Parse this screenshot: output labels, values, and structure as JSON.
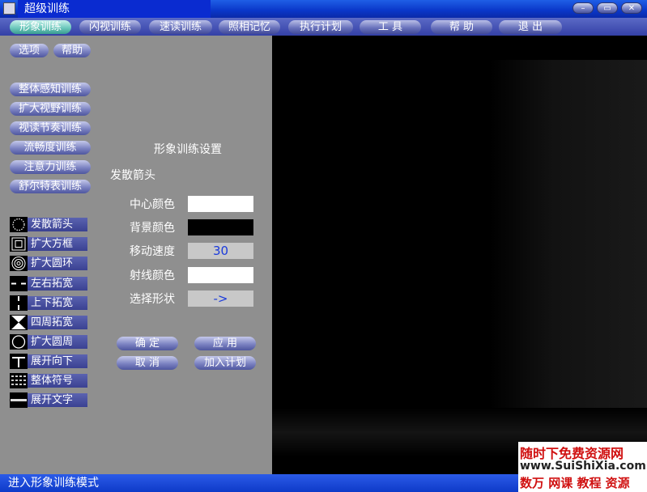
{
  "window": {
    "title": "超级训练",
    "minimize_glyph": "–",
    "maximize_glyph": "▭",
    "close_glyph": "✕"
  },
  "menu": [
    {
      "label": "形象训练",
      "active": true
    },
    {
      "label": "闪视训练"
    },
    {
      "label": "速读训练"
    },
    {
      "label": "照相记忆"
    },
    {
      "label": "执行计划"
    },
    {
      "label": "工 具"
    },
    {
      "label": "帮 助"
    },
    {
      "label": "退 出"
    }
  ],
  "sidebar": {
    "top_buttons": [
      "选项",
      "帮助"
    ],
    "training_buttons": [
      "整体感知训练",
      "扩大视野训练",
      "视读节奏训练",
      "流畅度训练",
      "注意力训练",
      "舒尔特表训练"
    ],
    "mode_items": [
      {
        "label": "发散箭头",
        "icon": "radial-dots-icon"
      },
      {
        "label": "扩大方框",
        "icon": "nested-square-icon"
      },
      {
        "label": "扩大圆环",
        "icon": "concentric-circle-icon"
      },
      {
        "label": "左右拓宽",
        "icon": "horizontal-dash-icon"
      },
      {
        "label": "上下拓宽",
        "icon": "vertical-dash-icon"
      },
      {
        "label": "四周拓宽",
        "icon": "hourglass-icon"
      },
      {
        "label": "扩大圆周",
        "icon": "circle-outline-icon"
      },
      {
        "label": "展开向下",
        "icon": "expand-down-icon"
      },
      {
        "label": "整体符号",
        "icon": "symbol-grid-icon"
      },
      {
        "label": "展开文字",
        "icon": "text-strip-icon"
      }
    ]
  },
  "settings": {
    "title": "形象训练设置",
    "mode_name": "发散箭头",
    "rows": [
      {
        "label": "中心颜色",
        "value": "",
        "color": "#ffffff"
      },
      {
        "label": "背景颜色",
        "value": "",
        "color": "#000000"
      },
      {
        "label": "移动速度",
        "value": "30",
        "color": "#c8c8c8"
      },
      {
        "label": "射线颜色",
        "value": "",
        "color": "#ffffff"
      },
      {
        "label": "选择形状",
        "value": "->",
        "color": "#c8c8c8"
      }
    ],
    "buttons": {
      "ok": "确 定",
      "apply": "应 用",
      "cancel": "取 消",
      "add_plan": "加入计划"
    }
  },
  "status": {
    "text": "进入形象训练模式"
  },
  "watermark": {
    "line1": "随时下免费资源网",
    "line2": "www.SuiShiXia.com",
    "line3": "数万 网课 教程 资源"
  },
  "colors": {
    "title_bar": "#0a36c8",
    "panel_gray": "#8f8f8f",
    "value_text_blue": "#1a3adc"
  }
}
